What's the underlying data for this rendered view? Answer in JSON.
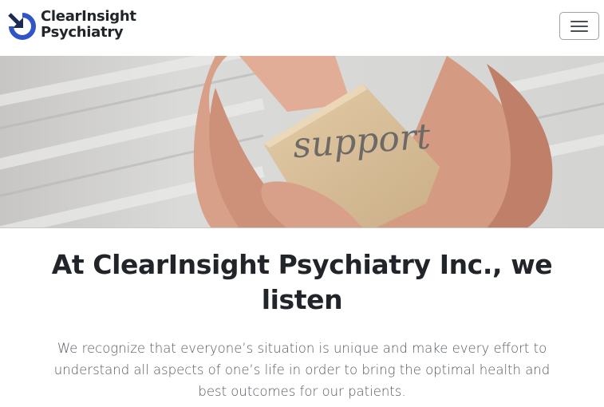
{
  "brand": {
    "line1": "ClearInsight",
    "line2": "Psychiatry",
    "colors": {
      "blue": "#2f55c9",
      "dark": "#1a2a52"
    },
    "icon": "circular-arrow-logo"
  },
  "nav": {
    "toggle_icon": "hamburger-menu-icon"
  },
  "hero": {
    "card_word": "support",
    "alt": "hands-holding-support-card"
  },
  "content": {
    "headline": "At ClearInsight Psychiatry Inc., we listen",
    "lead": "We recognize that everyone’s situation is unique and make every effort to understand all aspects of one’s life in order to bring the optimal health and best outcomes for our patients."
  }
}
